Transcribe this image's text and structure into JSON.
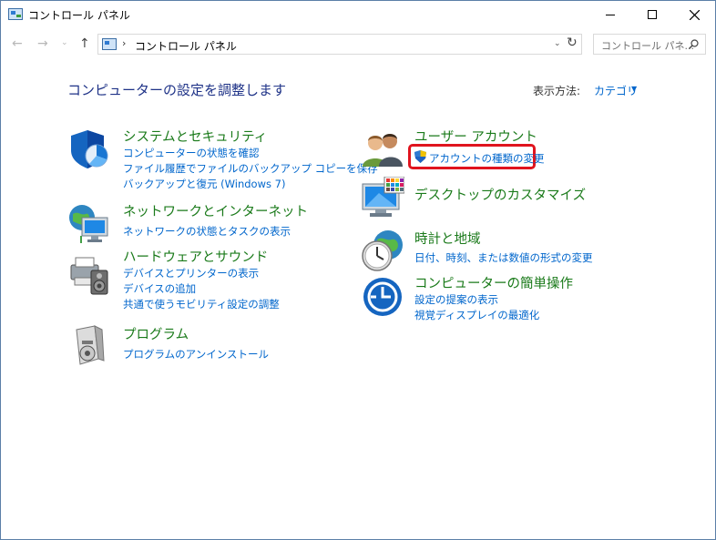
{
  "window": {
    "title": "コントロール パネル"
  },
  "address_bar": {
    "path": "コントロール パネル",
    "search_placeholder": "コントロール パネ..."
  },
  "main": {
    "heading": "コンピューターの設定を調整します",
    "view_by_label": "表示方法:",
    "view_by_value": "カテゴリ"
  },
  "categories": {
    "system": {
      "title": "システムとセキュリティ",
      "links": [
        "コンピューターの状態を確認",
        "ファイル履歴でファイルのバックアップ コピーを保存",
        "バックアップと復元 (Windows 7)"
      ]
    },
    "network": {
      "title": "ネットワークとインターネット",
      "links": [
        "ネットワークの状態とタスクの表示"
      ]
    },
    "hardware": {
      "title": "ハードウェアとサウンド",
      "links": [
        "デバイスとプリンターの表示",
        "デバイスの追加",
        "共通で使うモビリティ設定の調整"
      ]
    },
    "programs": {
      "title": "プログラム",
      "links": [
        "プログラムのアンインストール"
      ]
    },
    "accounts": {
      "title": "ユーザー アカウント",
      "links": [
        "アカウントの種類の変更"
      ]
    },
    "appearance": {
      "title": "デスクトップのカスタマイズ",
      "links": []
    },
    "clock": {
      "title": "時計と地域",
      "links": [
        "日付、時刻、または数値の形式の変更"
      ]
    },
    "ease": {
      "title": "コンピューターの簡単操作",
      "links": [
        "設定の提案の表示",
        "視覚ディスプレイの最適化"
      ]
    }
  },
  "colors": {
    "category_title": "#1a7a1a",
    "link": "#0066cc",
    "heading": "#1e3287",
    "highlight": "#e0141e"
  }
}
